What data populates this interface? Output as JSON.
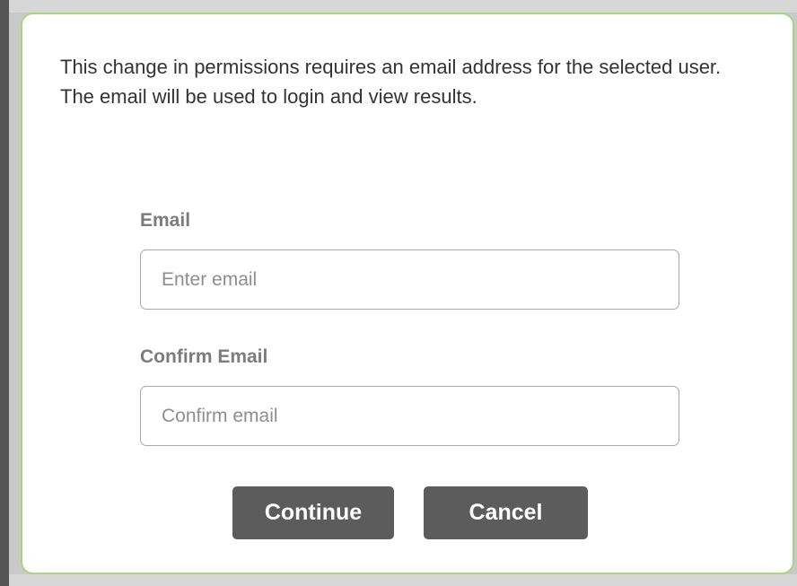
{
  "dialog": {
    "message": "This change in permissions requires an email address for the selected user. The email will be used to login and view results.",
    "email": {
      "label": "Email",
      "value": "",
      "placeholder": "Enter email"
    },
    "confirm_email": {
      "label": "Confirm Email",
      "value": "",
      "placeholder": "Confirm email"
    },
    "buttons": {
      "continue_label": "Continue",
      "cancel_label": "Cancel"
    }
  },
  "colors": {
    "dialog_border": "#a6d680",
    "button_background": "#5c5c5c",
    "label_text": "#7c7c7c",
    "backdrop": "#c9c9c9"
  }
}
